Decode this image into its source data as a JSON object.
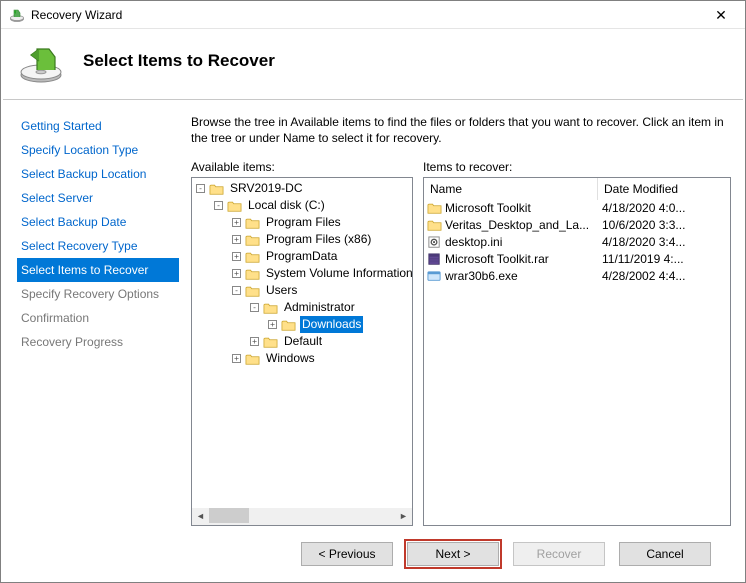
{
  "window_title": "Recovery Wizard",
  "page_heading": "Select Items to Recover",
  "instructions": "Browse the tree in Available items to find the files or folders that you want to recover. Click an item in the tree or under Name to select it for recovery.",
  "nav": {
    "items": [
      {
        "label": "Getting Started",
        "state": "done"
      },
      {
        "label": "Specify Location Type",
        "state": "done"
      },
      {
        "label": "Select Backup Location",
        "state": "done"
      },
      {
        "label": "Select Server",
        "state": "done"
      },
      {
        "label": "Select Backup Date",
        "state": "done"
      },
      {
        "label": "Select Recovery Type",
        "state": "done"
      },
      {
        "label": "Select Items to Recover",
        "state": "current"
      },
      {
        "label": "Specify Recovery Options",
        "state": "pending"
      },
      {
        "label": "Confirmation",
        "state": "pending"
      },
      {
        "label": "Recovery Progress",
        "state": "pending"
      }
    ]
  },
  "available_label": "Available items:",
  "items_label": "Items to recover:",
  "tree": [
    {
      "indent": 0,
      "exp": "-",
      "label": "SRV2019-DC",
      "sel": false
    },
    {
      "indent": 1,
      "exp": "-",
      "label": "Local disk (C:)",
      "sel": false
    },
    {
      "indent": 2,
      "exp": "+",
      "label": "Program Files",
      "sel": false
    },
    {
      "indent": 2,
      "exp": "+",
      "label": "Program Files (x86)",
      "sel": false
    },
    {
      "indent": 2,
      "exp": "+",
      "label": "ProgramData",
      "sel": false
    },
    {
      "indent": 2,
      "exp": "+",
      "label": "System Volume Information",
      "sel": false
    },
    {
      "indent": 2,
      "exp": "-",
      "label": "Users",
      "sel": false
    },
    {
      "indent": 3,
      "exp": "-",
      "label": "Administrator",
      "sel": false
    },
    {
      "indent": 4,
      "exp": "+",
      "label": "Downloads",
      "sel": true
    },
    {
      "indent": 3,
      "exp": "+",
      "label": "Default",
      "sel": false
    },
    {
      "indent": 2,
      "exp": "+",
      "label": "Windows",
      "sel": false
    }
  ],
  "list": {
    "columns": {
      "name": "Name",
      "date": "Date Modified"
    },
    "rows": [
      {
        "icon": "folder",
        "name": "Microsoft Toolkit",
        "date": "4/18/2020 4:0..."
      },
      {
        "icon": "folder",
        "name": "Veritas_Desktop_and_La...",
        "date": "10/6/2020 3:3..."
      },
      {
        "icon": "ini",
        "name": "desktop.ini",
        "date": "4/18/2020 3:4..."
      },
      {
        "icon": "rar",
        "name": "Microsoft Toolkit.rar",
        "date": "11/11/2019 4:..."
      },
      {
        "icon": "exe",
        "name": "wrar30b6.exe",
        "date": "4/28/2002 4:4..."
      }
    ]
  },
  "buttons": {
    "previous": "< Previous",
    "next": "Next >",
    "recover": "Recover",
    "cancel": "Cancel"
  }
}
